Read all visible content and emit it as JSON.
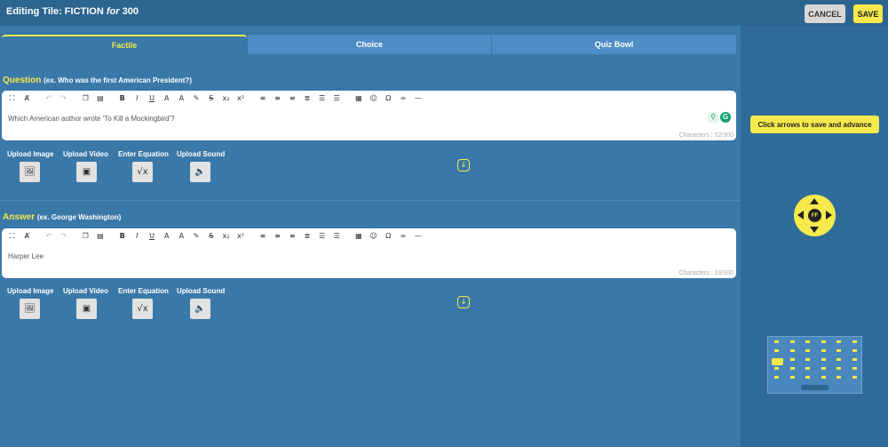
{
  "header": {
    "title_prefix": "Editing Tile: FICTION ",
    "title_for": "for",
    "title_value": " 300",
    "cancel_label": "CANCEL",
    "save_label": "SAVE"
  },
  "tabs": [
    {
      "label": "Factile",
      "active": true
    },
    {
      "label": "Choice",
      "active": false
    },
    {
      "label": "Quiz Bowl",
      "active": false
    }
  ],
  "question": {
    "label": "Question",
    "hint": "(ex. Who was the first American President?)",
    "text": "Which American author wrote 'To Kill a Mockingbird'?",
    "char_count": "Characters : 52/300"
  },
  "answer": {
    "label": "Answer",
    "hint": "(ex. George Washington)",
    "text": "Harper Lee",
    "char_count": "Characters : 10/300"
  },
  "uploads": [
    {
      "label": "Upload Image",
      "icon": "image-icon"
    },
    {
      "label": "Upload Video",
      "icon": "video-icon"
    },
    {
      "label": "Enter Equation",
      "icon": "equation-icon"
    },
    {
      "label": "Upload Sound",
      "icon": "sound-icon"
    }
  ],
  "toolbar_icons": [
    "fullscreen-icon",
    "clear-format-icon",
    "undo-icon",
    "redo-icon",
    "copy-icon",
    "paste-icon",
    "bold-icon",
    "italic-icon",
    "underline-icon",
    "font-size-icon",
    "text-color-icon",
    "highlight-icon",
    "strikethrough-icon",
    "subscript-icon",
    "superscript-icon",
    "align-left-icon",
    "align-center-icon",
    "align-right-icon",
    "justify-icon",
    "ordered-list-icon",
    "unordered-list-icon",
    "table-icon",
    "emoji-icon",
    "special-char-icon",
    "link-icon",
    "horizontal-rule-icon"
  ],
  "sidebar": {
    "tip": "Click arrows to save and advance",
    "joystick_label": "FF"
  },
  "colors": {
    "accent": "#f5e94c",
    "background": "#3a78a8",
    "topbar": "#2c6590",
    "tab": "#4e8ec6"
  }
}
